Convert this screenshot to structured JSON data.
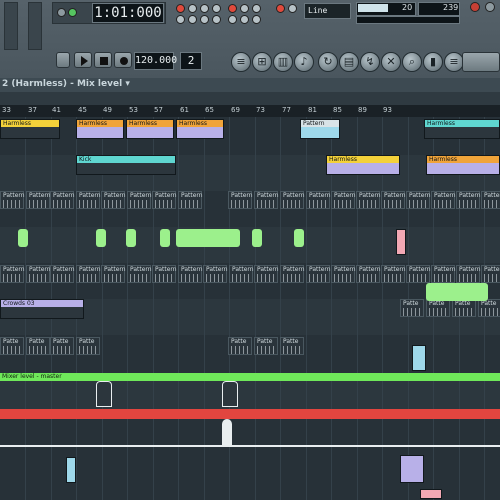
{
  "transport": {
    "time": "1:01:000",
    "tempo": "120.000",
    "pattern_num": "2",
    "snap": "Line",
    "cpu": "20",
    "poly": "239"
  },
  "playlist": {
    "title": "2 (Harmless) - Mix level",
    "arrow": "▾",
    "bars": [
      "33",
      "37",
      "41",
      "45",
      "49",
      "53",
      "57",
      "61",
      "65",
      "69",
      "73",
      "77",
      "81",
      "85",
      "89",
      "93"
    ]
  },
  "clips": {
    "harmless": "Harmless",
    "kick": "Kick",
    "pattern": "Pattern",
    "ob": "Patte",
    "sweep": "Crowds 03",
    "automation": "Mixer level - master"
  },
  "icons": {
    "play": "play-icon",
    "stop": "stop-icon",
    "record": "record-icon",
    "close": "close-icon"
  },
  "colors": {
    "toolbar": "#4c5860",
    "clip_orange": "#f0a43a",
    "clip_red": "#e8524a",
    "clip_teal": "#5fd6d0",
    "clip_yellow": "#f3d13a",
    "clip_green": "#9cf08c",
    "clip_purple": "#b8b0e8",
    "automation_green": "#6fe85a",
    "automation_red": "#e2453f"
  }
}
